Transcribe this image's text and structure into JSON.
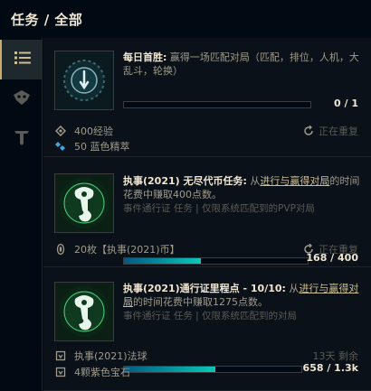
{
  "header": {
    "title": "任务 / 全部"
  },
  "sidebar": {
    "tabs": [
      "list",
      "monster",
      "tft"
    ]
  },
  "missions": [
    {
      "title": "每日首胜:",
      "desc": " 赢得一场匹配对局（匹配，排位，人机，大乱斗，轮换）",
      "progress_text": "0 / 1",
      "progress": 0,
      "rewards": [
        "400经验",
        "50 蓝色精萃"
      ],
      "status": "正在重复"
    },
    {
      "title": "执事(2021) 无尽代币任务:",
      "desc_pre": " 从",
      "desc_link": "进行与赢得对局",
      "desc_post": "的时间花费中赚取400点数。",
      "sub": "事件通行证 任务 | 仅限系统匹配到的PVP对局",
      "progress_text": "168 / 400",
      "progress": 0.42,
      "rewards": [
        "20枚【执事(2021)币】"
      ],
      "status": "正在重复"
    },
    {
      "title": "执事(2021)通行证里程点 - 10/10:",
      "desc_pre": " 从",
      "desc_link": "进行与赢得对局",
      "desc_post": "的时间花费中赚取1275点数。",
      "sub": "事件通行证 任务 | 仅限系统匹配到的对局",
      "progress_text": "658 / 1.3k",
      "progress": 0.516,
      "rewards": [
        "执事(2021)法球",
        "4颗紫色宝石"
      ],
      "status": "13天 剩余"
    }
  ]
}
